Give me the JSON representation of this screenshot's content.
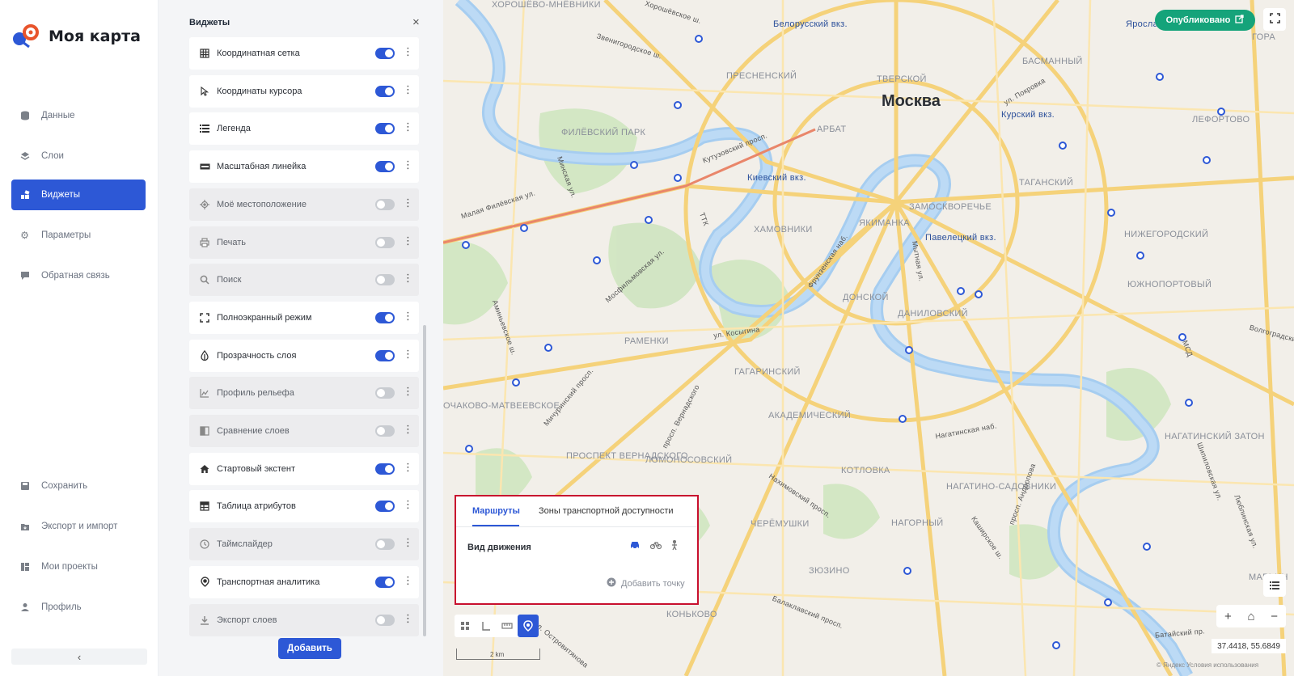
{
  "app": {
    "title": "Моя карта"
  },
  "nav": {
    "items": [
      {
        "label": "Данные",
        "icon": "database-icon"
      },
      {
        "label": "Слои",
        "icon": "layers-icon"
      },
      {
        "label": "Виджеты",
        "icon": "widgets-icon",
        "active": true
      },
      {
        "label": "Параметры",
        "icon": "gear-icon"
      },
      {
        "label": "Обратная связь",
        "icon": "feedback-icon"
      }
    ],
    "bottom": [
      {
        "label": "Сохранить",
        "icon": "save-icon"
      },
      {
        "label": "Экспорт и импорт",
        "icon": "export-import-icon"
      },
      {
        "label": "Мои проекты",
        "icon": "projects-icon"
      },
      {
        "label": "Профиль",
        "icon": "profile-icon"
      }
    ],
    "collapse_glyph": "‹"
  },
  "panel": {
    "title": "Виджеты",
    "close_glyph": "×",
    "add_label": "Добавить",
    "widgets": [
      {
        "label": "Координатная сетка",
        "icon": "grid-icon",
        "enabled": true
      },
      {
        "label": "Координаты курсора",
        "icon": "cursor-icon",
        "enabled": true
      },
      {
        "label": "Легенда",
        "icon": "legend-icon",
        "enabled": true
      },
      {
        "label": "Масштабная линейка",
        "icon": "ruler-icon",
        "enabled": true
      },
      {
        "label": "Моё местоположение",
        "icon": "location-icon",
        "enabled": false
      },
      {
        "label": "Печать",
        "icon": "print-icon",
        "enabled": false
      },
      {
        "label": "Поиск",
        "icon": "search-icon",
        "enabled": false
      },
      {
        "label": "Полноэкранный режим",
        "icon": "fullscreen-icon",
        "enabled": true
      },
      {
        "label": "Прозрачность слоя",
        "icon": "opacity-icon",
        "enabled": true
      },
      {
        "label": "Профиль рельефа",
        "icon": "relief-icon",
        "enabled": false
      },
      {
        "label": "Сравнение слоев",
        "icon": "compare-icon",
        "enabled": false
      },
      {
        "label": "Стартовый экстент",
        "icon": "home-icon",
        "enabled": true
      },
      {
        "label": "Таблица атрибутов",
        "icon": "table-icon",
        "enabled": true
      },
      {
        "label": "Таймслайдер",
        "icon": "clock-icon",
        "enabled": false
      },
      {
        "label": "Транспортная аналитика",
        "icon": "pin-icon",
        "enabled": true
      },
      {
        "label": "Экспорт слоев",
        "icon": "download-icon",
        "enabled": false
      }
    ]
  },
  "map": {
    "publish_label": "Опубликовано",
    "publish_color": "#15a37a",
    "city_label": "Москва",
    "district_labels": [
      "ХОРОШЁВО-МНЁВНИКИ",
      "ПРЕСНЕНСКИЙ",
      "ТВЕРСКОЙ",
      "БАСМАННЫЙ",
      "ГОРА",
      "ФИЛЁВСКИЙ ПАРК",
      "АРБАТ",
      "ЛЕФОРТОВО",
      "ТАГАНСКИЙ",
      "ЗАМОСКВОРЕЧЬЕ",
      "ЯКИМАНКА",
      "ХАМОВНИКИ",
      "НИЖЕГОРОДСКИЙ",
      "ЮЖНОПОРТОВЫЙ",
      "ДОНСКОЙ",
      "ДАНИЛОВСКИЙ",
      "РАМЕНКИ",
      "ГАГАРИНСКИЙ",
      "ОЧАКОВО-МАТВЕЕВСКОЕ",
      "АКАДЕМИЧЕСКИЙ",
      "НАГАТИНСКИЙ ЗАТОН",
      "ПРОСПЕКТ ВЕРНАДСКОГО",
      "ЛОМОНОСОВСКИЙ",
      "КОТЛОВКА",
      "НАГАТИНО-САДОВНИКИ",
      "ЧЕРЁМУШКИ",
      "НАГОРНЫЙ",
      "ЗЮЗИНО",
      "КОНЬКОВО",
      "МАРЬИН"
    ],
    "station_labels": [
      "Белорусский вкз.",
      "Ярославский вкз.",
      "Курский вкз.",
      "Киевский вкз.",
      "Павелецкий вкз."
    ],
    "road_labels": [
      "Хорошёвское ш.",
      "Звенигородское ш.",
      "ул. Покровка",
      "Кутузовский просп.",
      "Малая Филёвская ул.",
      "Минская ул.",
      "Мосфильмовская ул.",
      "Фрунзенская наб.",
      "ул. Косыгина",
      "Мичуринский просп.",
      "Аминьевское ш.",
      "просп. Вернадского",
      "Нахимовский просп.",
      "Нагатинская наб.",
      "Каширское ш.",
      "просп. Андропова",
      "Балаклавский просп.",
      "ул. Островитянова",
      "Волгоградский",
      "Батайский пр.",
      "Люблинская ул.",
      "МСД",
      "ТТК",
      "Мытная ул.",
      "Шипиловская ул."
    ],
    "coords": "37.4418, 55.6849",
    "attribution": "© Яндекс Условия использования",
    "scale_label": "2 km"
  },
  "routing": {
    "tabs": [
      "Маршруты",
      "Зоны транспортной доступности"
    ],
    "active_tab": "Маршруты",
    "mode_label": "Вид движения",
    "modes": [
      "car-icon",
      "bike-icon",
      "walk-icon"
    ],
    "add_point_label": "Добавить точку",
    "frame_color": "#c8102e"
  },
  "toolbar": {
    "tools": [
      "grid-tool-icon",
      "profile-tool-icon",
      "measure-tool-icon",
      "route-tool-icon"
    ],
    "active_tool": "route-tool-icon"
  },
  "map_controls": {
    "zoom_in": "+",
    "home": "⌂",
    "zoom_out": "−"
  },
  "colors": {
    "accent": "#2d58d6",
    "toggle_off": "#c9ccd1"
  }
}
